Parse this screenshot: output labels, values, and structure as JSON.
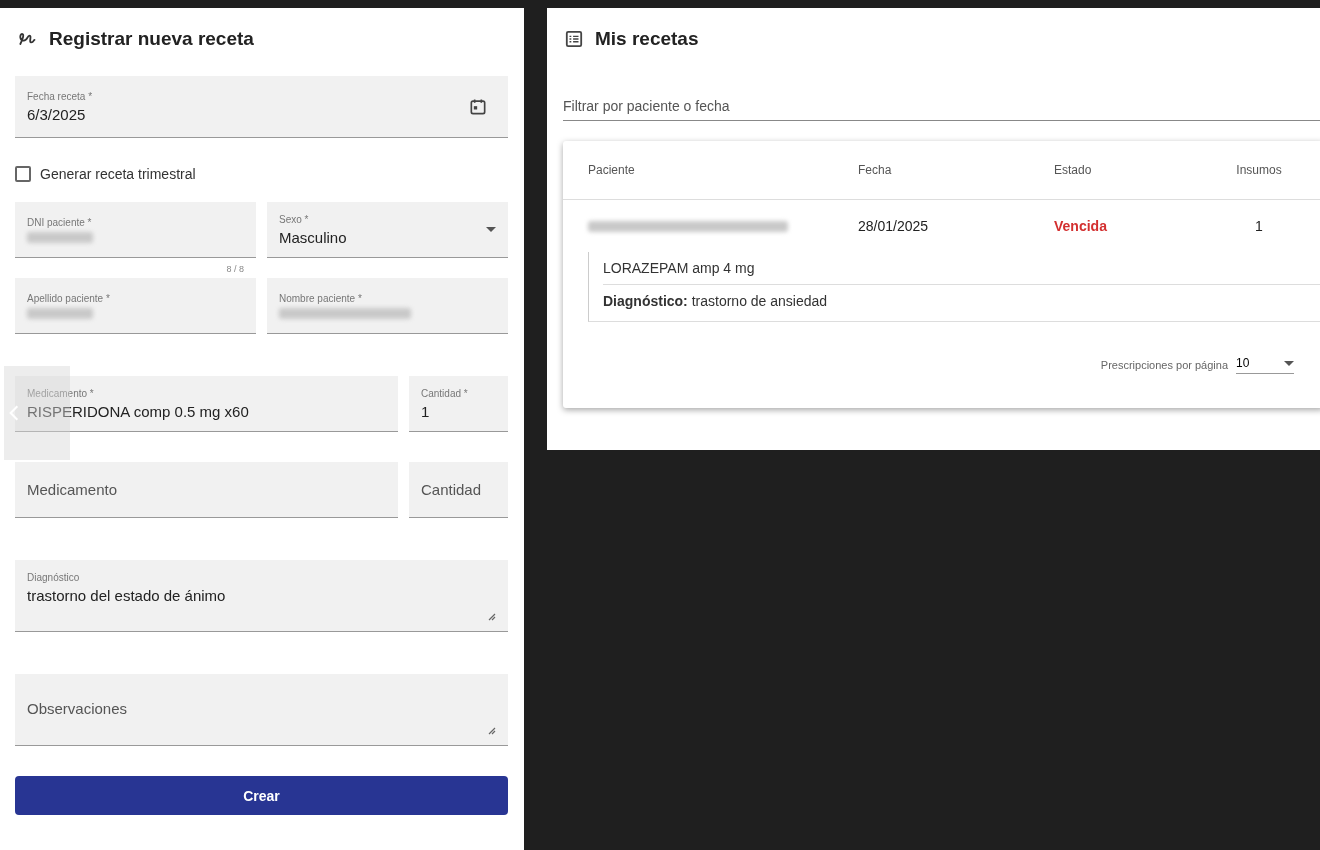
{
  "form": {
    "title": "Registrar nueva receta",
    "date_field": {
      "label": "Fecha receta *",
      "value": "6/3/2025"
    },
    "quarterly_checkbox": {
      "label": "Generar receta trimestral",
      "checked": false
    },
    "dni_field": {
      "label": "DNI paciente *",
      "counter": "8 / 8"
    },
    "sex_field": {
      "label": "Sexo *",
      "value": "Masculino"
    },
    "surname_field": {
      "label": "Apellido paciente *"
    },
    "name_field": {
      "label": "Nombre paciente *"
    },
    "medications": [
      {
        "label": "Medicamento *",
        "value": "RISPERIDONA comp 0.5 mg  x60",
        "quantity_label": "Cantidad *",
        "quantity": "1"
      },
      {
        "placeholder": "Medicamento",
        "quantity_placeholder": "Cantidad"
      }
    ],
    "diagnosis_field": {
      "label": "Diagnóstico",
      "value": "trastorno del estado de ánimo"
    },
    "notes_field": {
      "placeholder": "Observaciones"
    },
    "submit_button": "Crear"
  },
  "prescriptions": {
    "title": "Mis recetas",
    "filter": {
      "placeholder": "Filtrar por paciente o fecha"
    },
    "table": {
      "columns": [
        "Paciente",
        "Fecha",
        "Estado",
        "Insumos"
      ],
      "rows": [
        {
          "date": "28/01/2025",
          "status": "Vencida",
          "color": "#d32f2f",
          "supplies": "1",
          "expanded": true,
          "details": [
            "LORAZEPAM amp 4 mg",
            "**Diagnóstico:** trastorno de ansiedad"
          ]
        }
      ]
    },
    "paginator": {
      "label": "Prescripciones por página",
      "value": "10"
    }
  }
}
